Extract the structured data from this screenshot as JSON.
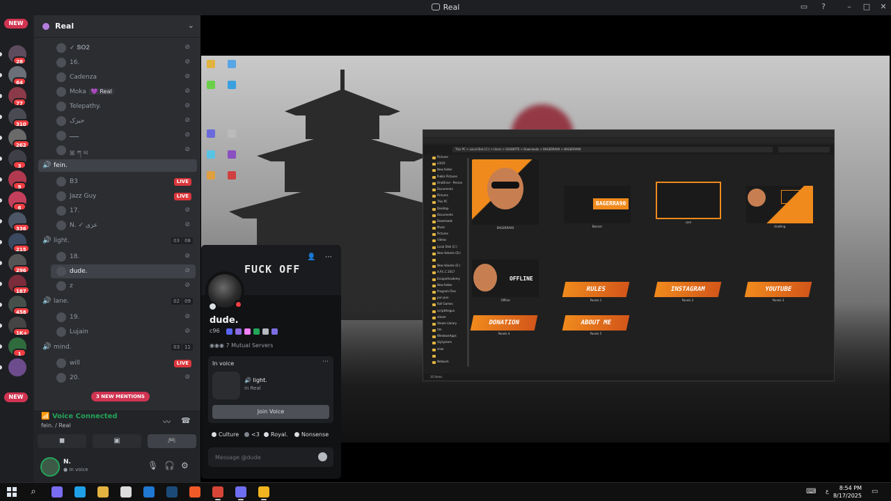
{
  "window": {
    "title": "Real"
  },
  "rail": {
    "new_top": "NEW",
    "new_bottom": "NEW",
    "servers": [
      {
        "badge": "28",
        "color": "#5d4b5e"
      },
      {
        "badge": "64",
        "color": "#6b6f78"
      },
      {
        "badge": "77",
        "color": "#8a3a48"
      },
      {
        "badge": "310",
        "color": "#4a4a55"
      },
      {
        "badge": "262",
        "color": "#6a6a6a"
      },
      {
        "badge": "3",
        "color": "#3f3f47"
      },
      {
        "badge": "9",
        "color": "#b23a50"
      },
      {
        "badge": "6",
        "color": "#c33f5c"
      },
      {
        "badge": "336",
        "color": "#4c5666"
      },
      {
        "badge": "215",
        "color": "#3b4960"
      },
      {
        "badge": "296",
        "color": "#555"
      },
      {
        "badge": "187",
        "color": "#7a2c3a"
      },
      {
        "badge": "458",
        "color": "#45504b"
      },
      {
        "badge": "1K+",
        "color": "#444"
      },
      {
        "badge": "1",
        "color": "#2f6b3d"
      },
      {
        "badge": "",
        "color": "#6c4c8c"
      }
    ]
  },
  "guild": {
    "name": "Real"
  },
  "members_top": [
    {
      "name": "✓ 𝐒𝐎𝟐"
    },
    {
      "name": "16."
    },
    {
      "name": "Cadenza"
    },
    {
      "name": "Moka",
      "tag": "💜 Real"
    },
    {
      "name": "Telepathy."
    },
    {
      "name": "حیزک"
    },
    {
      "name": "ـــــ"
    },
    {
      "name": "ꕤ ཀ ཡ"
    }
  ],
  "voice_channels": [
    {
      "name": "fein.",
      "count_a": "",
      "count_b": ""
    },
    {
      "name": "light.",
      "count_a": "03",
      "count_b": "08"
    },
    {
      "name": "lane.",
      "count_a": "02",
      "count_b": "09"
    },
    {
      "name": "mind.",
      "count_a": "03",
      "count_b": "11"
    }
  ],
  "fein_members": [
    {
      "name": "B3",
      "live": "LIVE"
    },
    {
      "name": "Jazz Guy",
      "live": "LIVE"
    },
    {
      "name": "17.",
      "live": ""
    },
    {
      "name": "N. ✓ عزی",
      "live": ""
    }
  ],
  "light_members": [
    {
      "name": "18."
    },
    {
      "name": "dude."
    },
    {
      "name": "z"
    }
  ],
  "lane_members": [
    {
      "name": "19."
    },
    {
      "name": "Lujain"
    }
  ],
  "mind_members": [
    {
      "name": "will",
      "live": "LIVE"
    },
    {
      "name": "20.",
      "live": ""
    }
  ],
  "mentions": "3 NEW MENTIONS",
  "voice_panel": {
    "status": "Voice Connected",
    "location": "fein. / Real"
  },
  "user_panel": {
    "name": "N.",
    "status": "In voice"
  },
  "profile": {
    "banner_text": "FUCK OFF",
    "display_name": "dude.",
    "tag_prefix": "c96",
    "mutual": "7 Mutual Servers",
    "in_voice_label": "In voice",
    "voice_channel": "🔊 light.",
    "voice_guild": "in Real",
    "join_label": "Join Voice",
    "roles": [
      "Culture",
      "<3",
      "Royal.",
      "Nonsense"
    ],
    "message_placeholder": "Message @dude"
  },
  "explorer": {
    "path": "This PC  >  Local Disk (C:)  >  Users  >  GIGABYTE  >  Downloads  >  BAGERRA90  >  BAGERRA90",
    "status": "10 items",
    "nav": [
      "Pictures",
      "LOGO",
      "New folder",
      "Public Pictures",
      "OneDrive - Person",
      "Documents",
      "Pictures",
      "This PC",
      "Desktop",
      "Documents",
      "Downloads",
      "Music",
      "Pictures",
      "Videos",
      "Local Disk (C:)",
      "New Volume (D:)",
      "",
      "New Volume (E:)",
      "A.P.C.C 2017",
      "EscapeAcademy",
      "New folder",
      "Program Files",
      "pun pun",
      "Roll Games",
      "scriptthegun",
      "steam",
      "Steam Library",
      "tlm",
      "WindowsApps",
      "XlySystem",
      "zmw",
      "",
      "Network"
    ],
    "items": [
      {
        "caption": "BAGERRA90",
        "banner": ""
      },
      {
        "caption": "Banner",
        "banner": "BAGERRA90"
      },
      {
        "caption": "cam",
        "banner": ""
      },
      {
        "caption": "chatting",
        "banner": ""
      },
      {
        "caption": "Offline",
        "banner": "OFFLINE"
      },
      {
        "caption": "Panels 1",
        "banner": "RULES"
      },
      {
        "caption": "Panels 2",
        "banner": "INSTAGRAM"
      },
      {
        "caption": "Panels 3",
        "banner": "YOUTUBE"
      },
      {
        "caption": "Panels 4",
        "banner": "DONATION"
      },
      {
        "caption": "Panels 5",
        "banner": "ABOUT ME"
      }
    ]
  },
  "taskbar": {
    "time": "8:54 PM",
    "date": "8/17/2025"
  }
}
